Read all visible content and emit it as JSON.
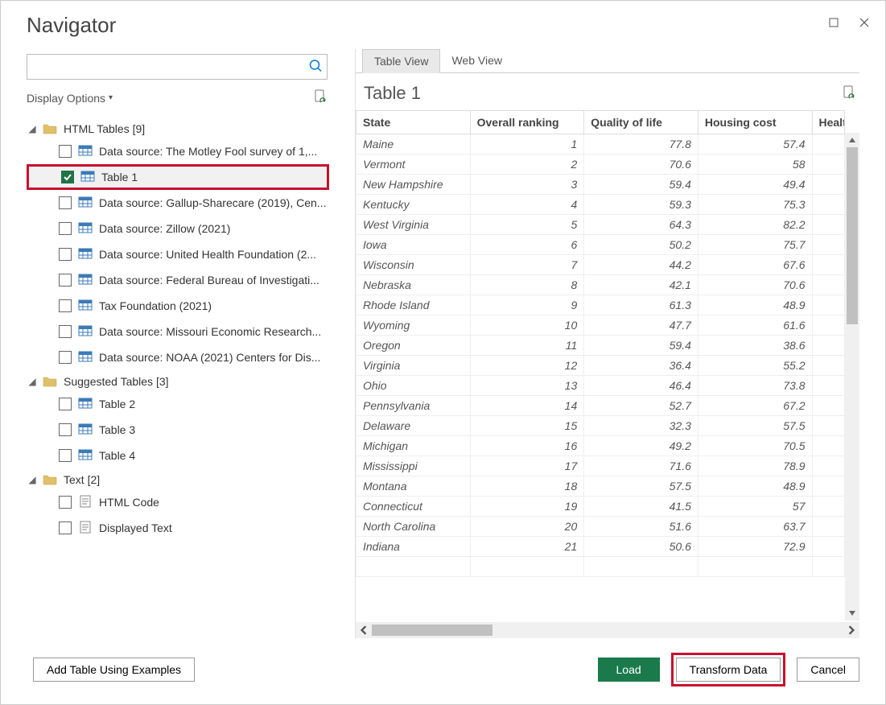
{
  "title": "Navigator",
  "left": {
    "display_options_label": "Display Options",
    "groups": [
      {
        "label": "HTML Tables [9]",
        "items": [
          {
            "label": "Data source: The Motley Fool survey of 1,...",
            "checked": false,
            "type": "table"
          },
          {
            "label": "Table 1",
            "checked": true,
            "type": "table",
            "selected": true,
            "highlight": true
          },
          {
            "label": "Data source: Gallup-Sharecare (2019), Cen...",
            "checked": false,
            "type": "table"
          },
          {
            "label": "Data source: Zillow (2021)",
            "checked": false,
            "type": "table"
          },
          {
            "label": "Data source: United Health Foundation (2...",
            "checked": false,
            "type": "table"
          },
          {
            "label": "Data source: Federal Bureau of Investigati...",
            "checked": false,
            "type": "table"
          },
          {
            "label": "Tax Foundation (2021)",
            "checked": false,
            "type": "table"
          },
          {
            "label": "Data source: Missouri Economic Research...",
            "checked": false,
            "type": "table"
          },
          {
            "label": "Data source: NOAA (2021) Centers for Dis...",
            "checked": false,
            "type": "table"
          }
        ]
      },
      {
        "label": "Suggested Tables [3]",
        "items": [
          {
            "label": "Table 2",
            "checked": false,
            "type": "table"
          },
          {
            "label": "Table 3",
            "checked": false,
            "type": "table"
          },
          {
            "label": "Table 4",
            "checked": false,
            "type": "table"
          }
        ]
      },
      {
        "label": "Text [2]",
        "items": [
          {
            "label": "HTML Code",
            "checked": false,
            "type": "text"
          },
          {
            "label": "Displayed Text",
            "checked": false,
            "type": "text"
          }
        ]
      }
    ]
  },
  "right": {
    "tabs": [
      {
        "label": "Table View",
        "active": true
      },
      {
        "label": "Web View",
        "active": false
      }
    ],
    "preview_title": "Table 1",
    "columns": [
      "State",
      "Overall ranking",
      "Quality of life",
      "Housing cost",
      "Health"
    ],
    "rows": [
      [
        "Maine",
        1,
        77.8,
        57.4
      ],
      [
        "Vermont",
        2,
        70.6,
        58
      ],
      [
        "New Hampshire",
        3,
        59.4,
        49.4
      ],
      [
        "Kentucky",
        4,
        59.3,
        75.3
      ],
      [
        "West Virginia",
        5,
        64.3,
        82.2
      ],
      [
        "Iowa",
        6,
        50.2,
        75.7
      ],
      [
        "Wisconsin",
        7,
        44.2,
        67.6
      ],
      [
        "Nebraska",
        8,
        42.1,
        70.6
      ],
      [
        "Rhode Island",
        9,
        61.3,
        48.9
      ],
      [
        "Wyoming",
        10,
        47.7,
        61.6
      ],
      [
        "Oregon",
        11,
        59.4,
        38.6
      ],
      [
        "Virginia",
        12,
        36.4,
        55.2
      ],
      [
        "Ohio",
        13,
        46.4,
        73.8
      ],
      [
        "Pennsylvania",
        14,
        52.7,
        67.2
      ],
      [
        "Delaware",
        15,
        32.3,
        57.5
      ],
      [
        "Michigan",
        16,
        49.2,
        70.5
      ],
      [
        "Mississippi",
        17,
        71.6,
        78.9
      ],
      [
        "Montana",
        18,
        57.5,
        48.9
      ],
      [
        "Connecticut",
        19,
        41.5,
        57
      ],
      [
        "North Carolina",
        20,
        51.6,
        63.7
      ],
      [
        "Indiana",
        21,
        50.6,
        72.9
      ]
    ]
  },
  "buttons": {
    "add_examples": "Add Table Using Examples",
    "load": "Load",
    "transform": "Transform Data",
    "cancel": "Cancel"
  }
}
